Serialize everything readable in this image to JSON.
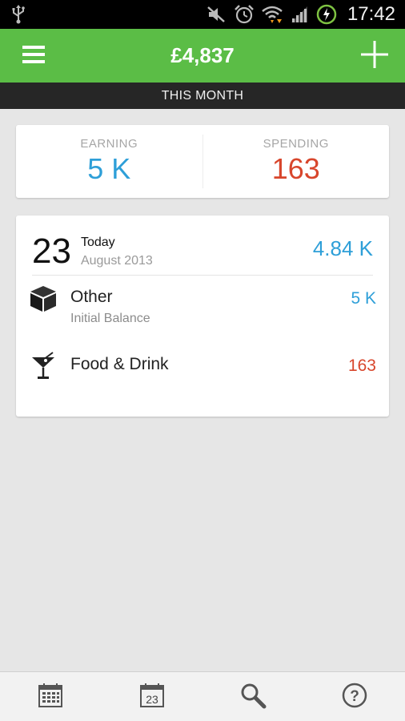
{
  "status_bar": {
    "time": "17:42",
    "icons": [
      "usb-icon",
      "mute-icon",
      "alarm-icon",
      "wifi-icon",
      "signal-icon",
      "battery-charging-icon"
    ]
  },
  "app_bar": {
    "balance": "£4,837",
    "menu_icon": "hamburger-menu-icon",
    "add_icon": "plus-icon",
    "background": "#5bbd46"
  },
  "period": {
    "label": "THIS MONTH"
  },
  "summary": {
    "earning_label": "EARNING",
    "earning_value": "5 K",
    "spending_label": "SPENDING",
    "spending_value": "163",
    "earning_color": "#2e9fd8",
    "spending_color": "#d8462c"
  },
  "day": {
    "number": "23",
    "label": "Today",
    "month_year": "August 2013",
    "total": "4.84 K"
  },
  "transactions": [
    {
      "icon": "box-icon",
      "name": "Other",
      "note": "Initial Balance",
      "amount": "5 K",
      "type": "earning"
    },
    {
      "icon": "cocktail-icon",
      "name": "Food & Drink",
      "note": "",
      "amount": "163",
      "type": "spending"
    }
  ],
  "bottom_nav": {
    "items": [
      "calendar-month-icon",
      "calendar-day-icon",
      "search-icon",
      "help-icon"
    ],
    "calendar_day_number": "23"
  }
}
